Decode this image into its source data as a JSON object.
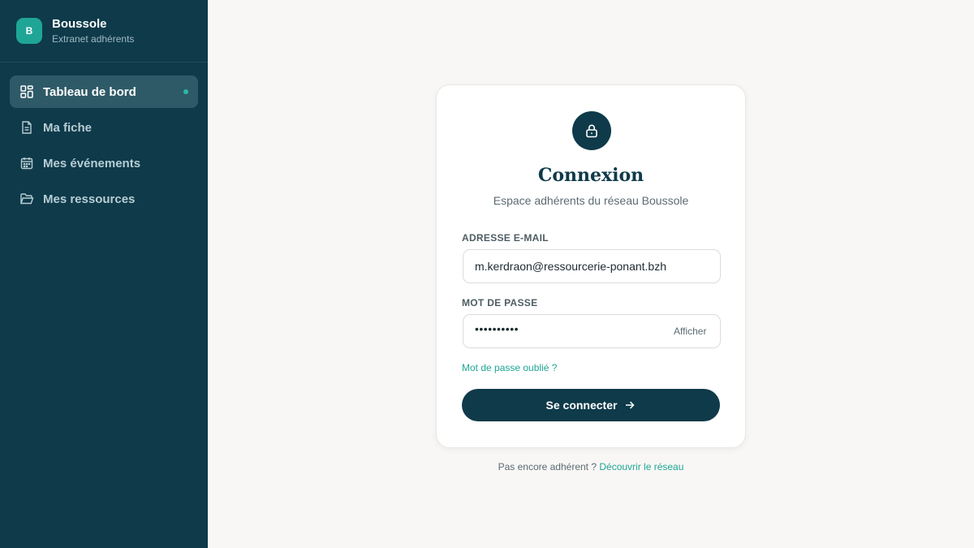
{
  "brand": {
    "logo_letter": "B",
    "name": "Boussole",
    "subtitle": "Extranet adhérents"
  },
  "sidebar": {
    "items": [
      {
        "label": "Tableau de bord",
        "icon": "dashboard-icon",
        "active": true
      },
      {
        "label": "Ma fiche",
        "icon": "document-icon",
        "active": false
      },
      {
        "label": "Mes événements",
        "icon": "calendar-icon",
        "active": false
      },
      {
        "label": "Mes ressources",
        "icon": "folder-icon",
        "active": false
      }
    ]
  },
  "login": {
    "icon": "lock-icon",
    "title": "Connexion",
    "subtitle": "Espace adhérents du réseau Boussole",
    "email_label": "ADRESSE E-MAIL",
    "email_value": "m.kerdraon@ressourcerie-ponant.bzh",
    "password_label": "MOT DE PASSE",
    "password_masked": "••••••••••",
    "show_label": "Afficher",
    "forgot_label": "Mot de passe oublié ?",
    "submit_label": "Se connecter"
  },
  "footer": {
    "prompt": "Pas encore adhérent ?",
    "link": "Découvrir le réseau"
  },
  "colors": {
    "sidebar_bg": "#0e3a4a",
    "accent": "#1fa596",
    "page_bg": "#f8f7f5"
  }
}
